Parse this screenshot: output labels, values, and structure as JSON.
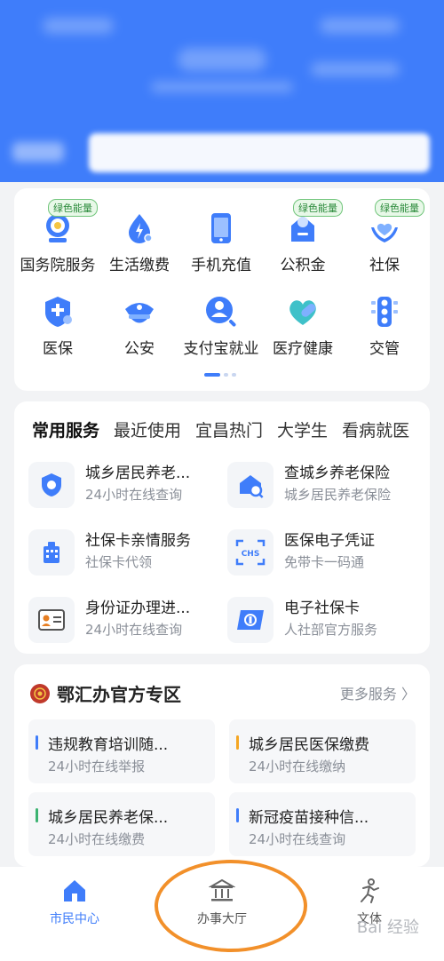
{
  "grid": {
    "items": [
      {
        "label": "国务院服务",
        "badge": "绿色能量"
      },
      {
        "label": "生活缴费"
      },
      {
        "label": "手机充值"
      },
      {
        "label": "公积金",
        "badge": "绿色能量"
      },
      {
        "label": "社保",
        "badge": "绿色能量"
      },
      {
        "label": "医保"
      },
      {
        "label": "公安"
      },
      {
        "label": "支付宝就业"
      },
      {
        "label": "医疗健康"
      },
      {
        "label": "交管"
      }
    ]
  },
  "services": {
    "tabs": [
      "常用服务",
      "最近使用",
      "宜昌热门",
      "大学生",
      "看病就医"
    ],
    "items": [
      {
        "title": "城乡居民养老...",
        "sub": "24小时在线查询"
      },
      {
        "title": "查城乡养老保险",
        "sub": "城乡居民养老保险"
      },
      {
        "title": "社保卡亲情服务",
        "sub": "社保卡代领"
      },
      {
        "title": "医保电子凭证",
        "sub": "免带卡一码通"
      },
      {
        "title": "身份证办理进...",
        "sub": "24小时在线查询"
      },
      {
        "title": "电子社保卡",
        "sub": "人社部官方服务"
      }
    ]
  },
  "zone": {
    "title": "鄂汇办官方专区",
    "more": "更多服务 〉",
    "items": [
      {
        "title": "违规教育培训随...",
        "sub": "24小时在线举报",
        "bar": "#3f7dfa"
      },
      {
        "title": "城乡居民医保缴费",
        "sub": "24小时在线缴纳",
        "bar": "#f5a623"
      },
      {
        "title": "城乡居民养老保...",
        "sub": "24小时在线缴费",
        "bar": "#3cb371"
      },
      {
        "title": "新冠疫苗接种信...",
        "sub": "24小时在线查询",
        "bar": "#3f7dfa"
      }
    ]
  },
  "nav": {
    "items": [
      {
        "label": "市民中心",
        "icon": "home-icon",
        "active": true
      },
      {
        "label": "办事大厅",
        "icon": "bank-icon"
      },
      {
        "label": "文体",
        "icon": "runner-icon"
      }
    ]
  },
  "watermark": "Bai 经验",
  "colors": {
    "primary": "#3f7dfa",
    "highlight": "#f2902a"
  }
}
